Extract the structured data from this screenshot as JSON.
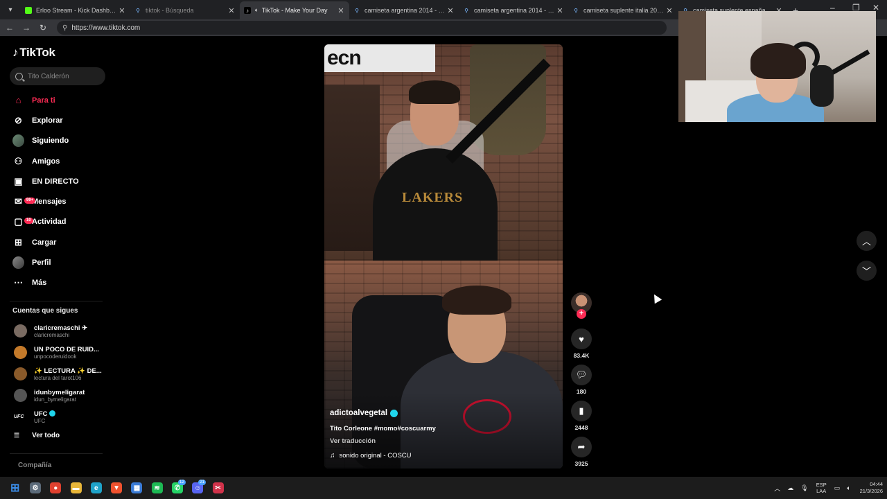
{
  "browser": {
    "tabs": [
      {
        "title": "Erloo Stream - Kick Dashboard",
        "favicon": "kick-icon",
        "active": false,
        "dim": false
      },
      {
        "title": "tiktok - Búsqueda",
        "favicon": "search-icon",
        "active": false,
        "dim": true
      },
      {
        "title": "TikTok - Make Your Day",
        "favicon": "tiktok-icon",
        "active": true,
        "dim": false
      },
      {
        "title": "camiseta argentina 2014 - Búsqueda",
        "favicon": "search-icon",
        "active": false,
        "dim": false
      },
      {
        "title": "camiseta argentina 2014 - Búsqueda",
        "favicon": "search-icon",
        "active": false,
        "dim": false
      },
      {
        "title": "camiseta suplente italia 2026 - Bú",
        "favicon": "search-icon",
        "active": false,
        "dim": false
      },
      {
        "title": "camiseta suplente españa 2026 -",
        "favicon": "search-icon",
        "active": false,
        "dim": false
      }
    ],
    "url": "https://www.tiktok.com"
  },
  "sidebar": {
    "logo": "TikTok",
    "search_placeholder": "Tito Calderón",
    "nav": [
      {
        "label": "Para ti",
        "icon": "home-icon",
        "active": true
      },
      {
        "label": "Explorar",
        "icon": "compass-icon",
        "active": false
      },
      {
        "label": "Siguiendo",
        "icon": "following-avatar-icon",
        "active": false
      },
      {
        "label": "Amigos",
        "icon": "friends-icon",
        "active": false
      },
      {
        "label": "EN DIRECTO",
        "icon": "live-icon",
        "active": false
      },
      {
        "label": "Mensajes",
        "icon": "messages-icon",
        "active": false,
        "badge": "99+"
      },
      {
        "label": "Actividad",
        "icon": "activity-icon",
        "active": false,
        "badge": "10"
      },
      {
        "label": "Cargar",
        "icon": "upload-icon",
        "active": false
      },
      {
        "label": "Perfil",
        "icon": "profile-avatar-icon",
        "active": false
      },
      {
        "label": "Más",
        "icon": "more-icon",
        "active": false
      }
    ],
    "following_title": "Cuentas que sigues",
    "following": [
      {
        "name": "claricremaschi ✈",
        "handle": "claricremaschi",
        "color": "#7a6b62",
        "verified": false
      },
      {
        "name": "UN POCO DE RUID...",
        "handle": "unpocoderuidook",
        "color": "#c47a2a",
        "verified": false
      },
      {
        "name": "✨ LECTURA ✨ DE...",
        "handle": "lectura del tarot106",
        "color": "#8a5a2a",
        "verified": false
      },
      {
        "name": "idunbymeligarat",
        "handle": "idun_bymeligarat",
        "color": "#555555",
        "verified": false
      },
      {
        "name": "UFC",
        "handle": "UFC",
        "color": "#000000",
        "verified": true
      }
    ],
    "see_all": "Ver todo",
    "company": "Compañía"
  },
  "video": {
    "sign_text": "ecn",
    "shirt_text": "LAKERS",
    "username": "adictoalvegetal",
    "description": "Tito Corleone #momo#coscuarmy",
    "translate": "Ver traducción",
    "sound": "sonido original - COSCU"
  },
  "actions": {
    "likes": "83.4K",
    "comments": "180",
    "saves": "2448",
    "shares": "3925"
  },
  "taskbar": {
    "apps": [
      {
        "name": "windows-start-icon",
        "color": "#3b8eea",
        "glyph": "⊞"
      },
      {
        "name": "settings-icon",
        "color": "#5c6b7a",
        "glyph": "⚙"
      },
      {
        "name": "chrome-icon",
        "color": "#e0412f",
        "glyph": "●"
      },
      {
        "name": "file-explorer-icon",
        "color": "#e8b63a",
        "glyph": "▬"
      },
      {
        "name": "edge-icon",
        "color": "#1fa3c9",
        "glyph": "e"
      },
      {
        "name": "brave-icon",
        "color": "#f0522e",
        "glyph": "▼"
      },
      {
        "name": "store-icon",
        "color": "#3a7bd5",
        "glyph": "▦"
      },
      {
        "name": "spotify-icon",
        "color": "#1db954",
        "glyph": "≋"
      },
      {
        "name": "whatsapp-icon",
        "color": "#25d366",
        "glyph": "✆",
        "badge": "12"
      },
      {
        "name": "discord-icon",
        "color": "#5865f2",
        "glyph": "☺",
        "badge": "21"
      },
      {
        "name": "snipping-tool-icon",
        "color": "#d1324a",
        "glyph": "✂"
      }
    ],
    "lang_top": "ESP",
    "lang_bottom": "LAA",
    "time": "04:44",
    "date": "21/3/2026"
  }
}
